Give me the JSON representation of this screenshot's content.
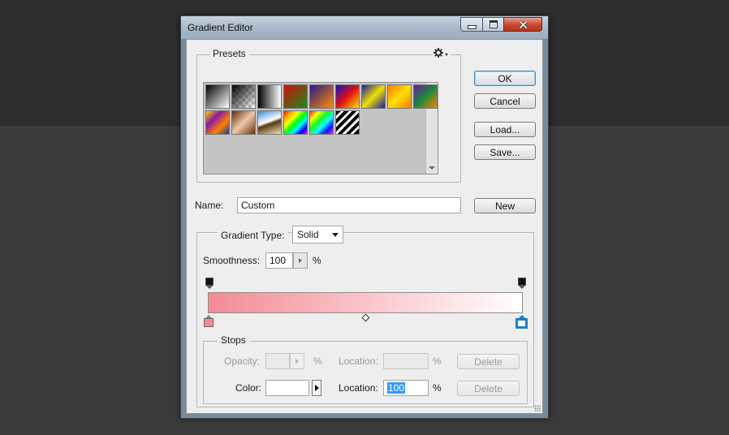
{
  "window": {
    "title": "Gradient Editor"
  },
  "presets": {
    "legend": "Presets",
    "swatches": [
      {
        "name": "foreground-to-background",
        "bg": "linear-gradient(135deg,#000,#fff)"
      },
      {
        "name": "foreground-to-transparent",
        "bg": "linear-gradient(135deg,#000,rgba(0,0,0,0)), repeating-conic-gradient(#ccc 0 25%, #fff 0 50%) 0 0/8px 8px"
      },
      {
        "name": "black-white",
        "bg": "linear-gradient(90deg,#000,#fff)"
      },
      {
        "name": "red-green",
        "bg": "linear-gradient(135deg,#d01010,#1a8a1a)"
      },
      {
        "name": "violet-orange",
        "bg": "linear-gradient(135deg,#2a1a8a,#ff8a00)"
      },
      {
        "name": "blue-red-yellow",
        "bg": "linear-gradient(135deg,#1010c0,#e01010,#ffe000)"
      },
      {
        "name": "blue-yellow-blue",
        "bg": "linear-gradient(135deg,#1a1aa0,#f0e000,#1a1aa0)"
      },
      {
        "name": "orange-yellow-orange",
        "bg": "linear-gradient(135deg,#ff7a00,#ffe000,#ff7a00)"
      },
      {
        "name": "violet-green-orange",
        "bg": "linear-gradient(135deg,#6a1aa0,#1a8a3a,#ff8000)"
      },
      {
        "name": "yellow-violet-orange-blue",
        "bg": "linear-gradient(135deg,#ffd000,#8a1aa0,#ff8000,#1a3aa0)"
      },
      {
        "name": "copper",
        "bg": "linear-gradient(135deg,#5a2a10,#f0c8a8,#6a3010)"
      },
      {
        "name": "chrome",
        "bg": "linear-gradient(160deg,#3a8ad0,#ffffff 45%,#5a3a10 55%,#f0e0c0)"
      },
      {
        "name": "spectrum",
        "bg": "linear-gradient(135deg,red,orange,yellow,lime,cyan,blue,magenta)"
      },
      {
        "name": "transparent-rainbow",
        "bg": "linear-gradient(135deg,rgba(255,0,0,.9),rgba(255,255,0,.9),rgba(0,255,0,.9),rgba(0,255,255,.9),rgba(0,0,255,.9),rgba(255,0,255,.9)), repeating-conic-gradient(#ccc 0 25%, #fff 0 50%) 0 0/8px 8px"
      },
      {
        "name": "transparent-stripes",
        "bg": "repeating-linear-gradient(135deg,#000 0 4px,#fff 4px 7px)"
      }
    ]
  },
  "buttons": {
    "ok": "OK",
    "cancel": "Cancel",
    "load": "Load...",
    "save": "Save...",
    "new": "New"
  },
  "name_field": {
    "label": "Name:",
    "value": "Custom"
  },
  "gradient": {
    "type_label": "Gradient Type:",
    "type_value": "Solid",
    "smoothness_label": "Smoothness:",
    "smoothness_value": "100",
    "smoothness_unit": "%",
    "start_color": "#f48a94",
    "end_color": "#ffffff"
  },
  "stops": {
    "legend": "Stops",
    "opacity_label": "Opacity:",
    "opacity_unit": "%",
    "location_label": "Location:",
    "location_unit": "%",
    "delete_label": "Delete",
    "color_label": "Color:",
    "color_location_value": "100",
    "color_swatch": "#ffffff",
    "selected_color": "#1e7fc8"
  }
}
